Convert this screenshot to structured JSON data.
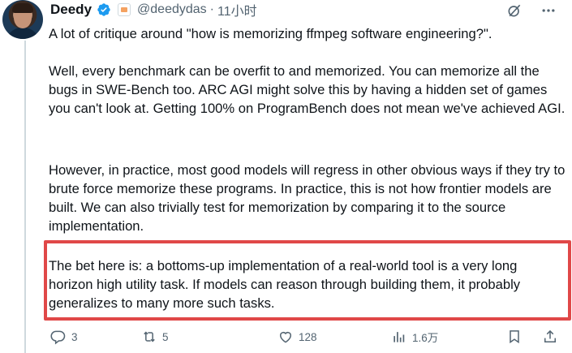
{
  "author": {
    "name": "Deedy",
    "handle": "@deedydas",
    "separator": "·",
    "time": "11小时"
  },
  "tweet": {
    "paragraph_1": "A lot of critique around \"how is memorizing ffmpeg software engineering?\".",
    "paragraph_2": "Well, every benchmark can be overfit to and memorized. You can memorize all the bugs in SWE-Bench too. ARC AGI might solve this by having a hidden set of games you can't look at. Getting 100% on ProgramBench does not mean we've achieved AGI.",
    "paragraph_3": "However, in practice, most good models will regress in other obvious ways if they try to brute force memorize these programs. In practice, this is not how frontier models are built. We can also trivially test for memorization by comparing it to the source implementation.",
    "paragraph_4": "The bet here is: a bottoms-up implementation of a real-world tool is a very long horizon high utility task. If models can reason through building them, it probably generalizes to many more such tasks."
  },
  "metrics": {
    "replies": "3",
    "reposts": "5",
    "likes": "128",
    "views": "1.6万"
  },
  "colors": {
    "verified": "#1d9bf0",
    "highlight": "#e04848",
    "muted": "#536471"
  },
  "icons": {
    "top_right": [
      "grok-icon",
      "more-icon"
    ],
    "actions": [
      "reply-icon",
      "repost-icon",
      "like-icon",
      "views-icon",
      "bookmark-icon",
      "share-icon"
    ]
  }
}
